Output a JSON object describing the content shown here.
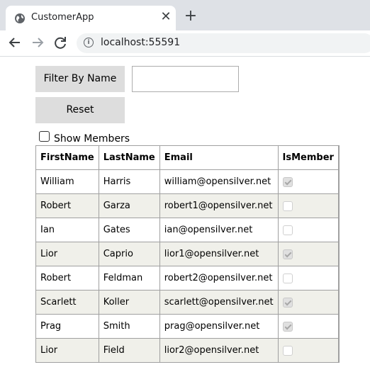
{
  "browser": {
    "tab_title": "CustomerApp",
    "close_glyph": "✕",
    "new_tab_glyph": "+",
    "url": "localhost:55591",
    "info_glyph": "i"
  },
  "controls": {
    "filter_button": "Filter By Name",
    "reset_button": "Reset",
    "name_input_value": "",
    "show_members_label": "Show Members",
    "show_members_checked": false
  },
  "grid": {
    "headers": [
      "FirstName",
      "LastName",
      "Email",
      "IsMember"
    ],
    "rows": [
      {
        "first": "William",
        "last": "Harris",
        "email": "william@opensilver.net",
        "member": true
      },
      {
        "first": "Robert",
        "last": "Garza",
        "email": "robert1@opensilver.net",
        "member": false
      },
      {
        "first": "Ian",
        "last": "Gates",
        "email": "ian@opensilver.net",
        "member": false
      },
      {
        "first": "Lior",
        "last": "Caprio",
        "email": "lior1@opensilver.net",
        "member": true
      },
      {
        "first": "Robert",
        "last": "Feldman",
        "email": "robert2@opensilver.net",
        "member": false
      },
      {
        "first": "Scarlett",
        "last": "Koller",
        "email": "scarlett@opensilver.net",
        "member": true
      },
      {
        "first": "Prag",
        "last": "Smith",
        "email": "prag@opensilver.net",
        "member": true
      },
      {
        "first": "Lior",
        "last": "Field",
        "email": "lior2@opensilver.net",
        "member": false
      }
    ]
  }
}
